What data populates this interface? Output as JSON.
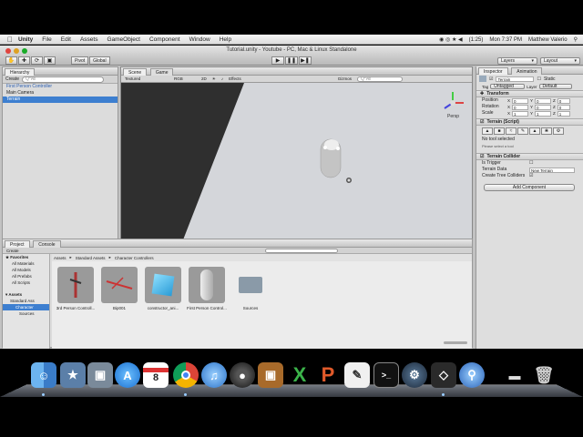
{
  "menubar": {
    "app": "Unity",
    "items": [
      "File",
      "Edit",
      "Assets",
      "GameObject",
      "Component",
      "Window",
      "Help"
    ],
    "battery": "(1:25)",
    "clock": "Mon 7:37 PM",
    "user": "Matthew Valerio"
  },
  "window": {
    "title": "Tutorial.unity - Youtube - PC, Mac & Linux Standalone",
    "pivot": "Pivot",
    "global": "Global",
    "layers": "Layers",
    "layout": "Layout"
  },
  "hierarchy": {
    "tab": "Hierarchy",
    "create": "Create",
    "search_placeholder": "Q*All",
    "items": [
      "First Person Controller",
      "Main Camera",
      "Terrain"
    ]
  },
  "scene": {
    "tab_scene": "Scene",
    "tab_game": "Game",
    "render_mode": "Textured",
    "color_mode": "RGB",
    "mode_2d": "2D",
    "effects": "Effects",
    "gizmos": "Gizmos",
    "search": "Q*All",
    "persp": "Persp"
  },
  "inspector": {
    "tab": "Inspector",
    "tab2": "Animation",
    "object_name": "Terrain",
    "static": "Static",
    "tag_label": "Tag",
    "tag_value": "Untagged",
    "layer_label": "Layer",
    "layer_value": "Default",
    "transform": "Transform",
    "position": {
      "label": "Position",
      "x": "0",
      "y": "0",
      "z": "0"
    },
    "rotation": {
      "label": "Rotation",
      "x": "0",
      "y": "0",
      "z": "0"
    },
    "scale": {
      "label": "Scale",
      "x": "1",
      "y": "1",
      "z": "1"
    },
    "terrain_script": "Terrain (Script)",
    "no_tool": "No tool selected",
    "select_tool": "Please select a tool",
    "terrain_collider": "Terrain Collider",
    "is_trigger": "Is Trigger",
    "terrain_data_label": "Terrain Data",
    "terrain_data_value": "New Terrain",
    "create_tree": "Create Tree Colliders",
    "add_component": "Add Component"
  },
  "project": {
    "tab": "Project",
    "tab2": "Console",
    "create": "Create",
    "breadcrumb": [
      "Assets",
      "Standard Assets",
      "Character Controllers"
    ],
    "favorites_label": "Favorites",
    "favorites": [
      "All Materials",
      "All Models",
      "All Prefabs",
      "All Scripts"
    ],
    "assets_label": "Assets",
    "tree": [
      "Standard Ass",
      "Character",
      "Sources"
    ],
    "items": [
      {
        "label": "3rd Person Controll..."
      },
      {
        "label": "Bip001"
      },
      {
        "label": "constructor_ani..."
      },
      {
        "label": "First Person Control..."
      },
      {
        "label": "Sources"
      }
    ]
  },
  "colors": {
    "selection": "#3d7fd0",
    "scene_bg": "#2f2f2f",
    "ground": "#d4d6da"
  },
  "dock": {
    "icons": [
      "finder-icon",
      "preview-icon",
      "photo-icon",
      "app-store-icon",
      "calendar-icon",
      "chrome-icon",
      "itunes-icon",
      "dvd-icon",
      "photo-booth-icon",
      "excel-icon",
      "powerpoint-icon",
      "textedit-icon",
      "terminal-icon",
      "steam-icon",
      "unity-icon",
      "network-icon",
      "display-icon",
      "trash-icon"
    ],
    "calendar_day": "8"
  }
}
